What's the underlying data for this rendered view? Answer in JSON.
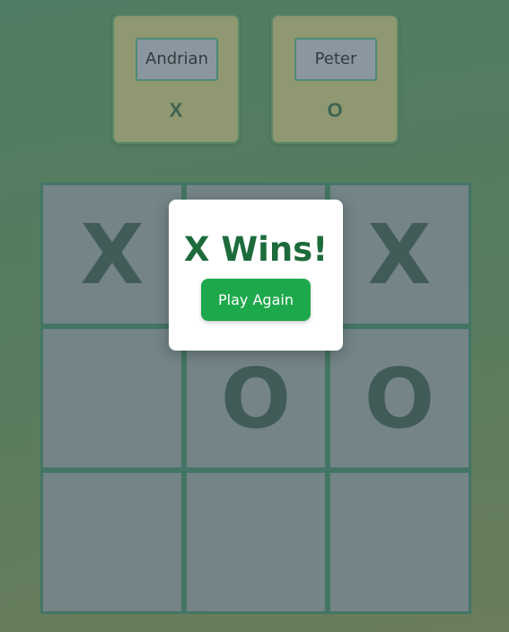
{
  "players": [
    {
      "name": "Andrian",
      "mark": "X"
    },
    {
      "name": "Peter",
      "mark": "O"
    }
  ],
  "board": {
    "cells": [
      "X",
      "",
      "X",
      "",
      "O",
      "O",
      "",
      "",
      ""
    ]
  },
  "modal": {
    "title": "X Wins!",
    "button_label": "Play Again"
  },
  "colors": {
    "accent": "#1ea84c",
    "title": "#1d6b3c"
  }
}
